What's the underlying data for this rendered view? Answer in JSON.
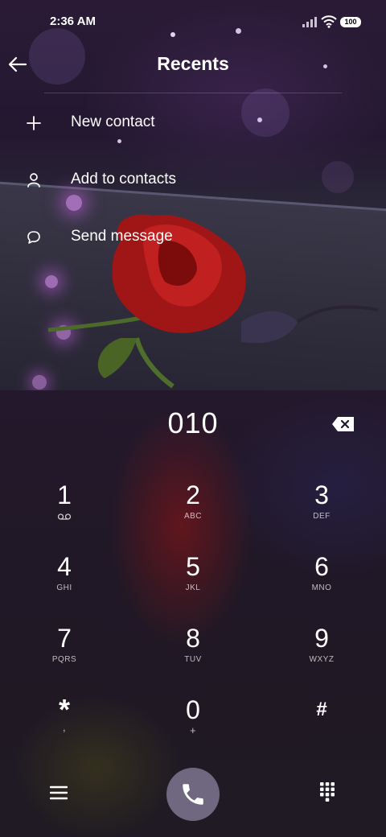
{
  "status_bar": {
    "time": "2:36 AM",
    "battery": "100"
  },
  "header": {
    "title": "Recents"
  },
  "menu": {
    "items": [
      {
        "label": "New contact",
        "icon": "plus-icon"
      },
      {
        "label": "Add to contacts",
        "icon": "person-icon"
      },
      {
        "label": "Send message",
        "icon": "chat-bubble-icon"
      }
    ]
  },
  "dialer": {
    "number": "010",
    "keys": [
      {
        "digit": "1",
        "sub": ""
      },
      {
        "digit": "2",
        "sub": "ABC"
      },
      {
        "digit": "3",
        "sub": "DEF"
      },
      {
        "digit": "4",
        "sub": "GHI"
      },
      {
        "digit": "5",
        "sub": "JKL"
      },
      {
        "digit": "6",
        "sub": "MNO"
      },
      {
        "digit": "7",
        "sub": "PQRS"
      },
      {
        "digit": "8",
        "sub": "TUV"
      },
      {
        "digit": "9",
        "sub": "WXYZ"
      },
      {
        "digit": "*",
        "sub": ","
      },
      {
        "digit": "0",
        "sub": "+"
      },
      {
        "digit": "#",
        "sub": ""
      }
    ]
  },
  "colors": {
    "call_button": "#6f6880",
    "rose": "#b01818"
  }
}
